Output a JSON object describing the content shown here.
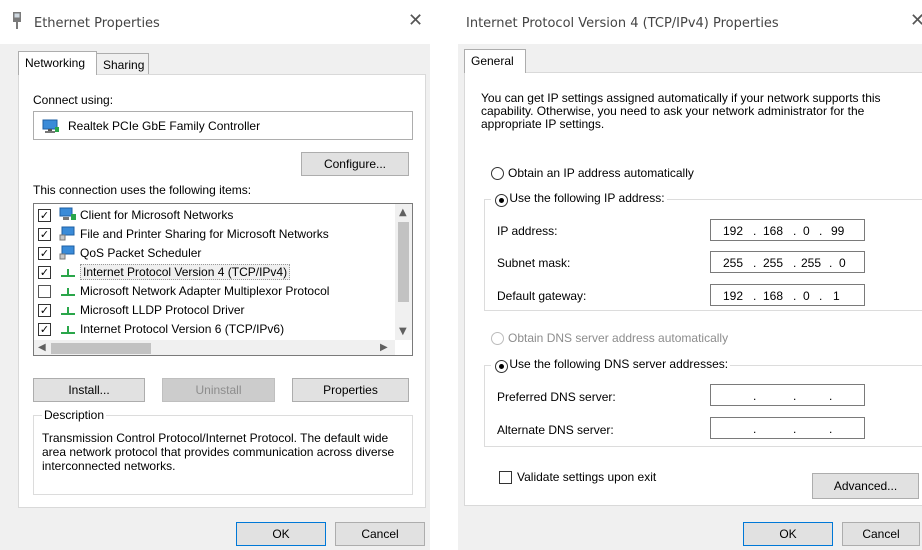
{
  "ethernet": {
    "title": "Ethernet Properties",
    "close_glyph": "✕",
    "tabs": [
      "Networking",
      "Sharing"
    ],
    "connect_using_label": "Connect using:",
    "adapter_name": "Realtek PCIe GbE Family Controller",
    "configure_label": "Configure...",
    "items_label": "This connection uses the following items:",
    "items": [
      {
        "label": "Client for Microsoft Networks",
        "checked": true,
        "icon": "network-client-icon"
      },
      {
        "label": "File and Printer Sharing for Microsoft Networks",
        "checked": true,
        "icon": "network-service-icon"
      },
      {
        "label": "QoS Packet Scheduler",
        "checked": true,
        "icon": "network-service-icon"
      },
      {
        "label": "Internet Protocol Version 4 (TCP/IPv4)",
        "checked": true,
        "selected": true,
        "icon": "protocol-icon"
      },
      {
        "label": "Microsoft Network Adapter Multiplexor Protocol",
        "checked": false,
        "icon": "protocol-icon"
      },
      {
        "label": "Microsoft LLDP Protocol Driver",
        "checked": true,
        "icon": "protocol-icon"
      },
      {
        "label": "Internet Protocol Version 6 (TCP/IPv6)",
        "checked": true,
        "icon": "protocol-icon"
      }
    ],
    "install_label": "Install...",
    "uninstall_label": "Uninstall",
    "properties_label": "Properties",
    "description_title": "Description",
    "description_text": "Transmission Control Protocol/Internet Protocol. The default wide area network protocol that provides communication across diverse interconnected networks.",
    "ok_label": "OK",
    "cancel_label": "Cancel"
  },
  "ipv4": {
    "title": "Internet Protocol Version 4 (TCP/IPv4) Properties",
    "close_glyph": "✕",
    "tab": "General",
    "intro": "You can get IP settings assigned automatically if your network supports this capability. Otherwise, you need to ask your network administrator for the appropriate IP settings.",
    "obtain_ip_auto": "Obtain an IP address automatically",
    "use_following_ip": "Use the following IP address:",
    "ip_address_label": "IP address:",
    "subnet_mask_label": "Subnet mask:",
    "gateway_label": "Default gateway:",
    "ip_address": [
      "192",
      "168",
      "0",
      "99"
    ],
    "subnet_mask": [
      "255",
      "255",
      "255",
      "0"
    ],
    "gateway": [
      "192",
      "168",
      "0",
      "1"
    ],
    "obtain_dns_auto": "Obtain DNS server address automatically",
    "use_following_dns": "Use the following DNS server addresses:",
    "preferred_dns_label": "Preferred DNS server:",
    "alternate_dns_label": "Alternate DNS server:",
    "validate_label": "Validate settings upon exit",
    "advanced_label": "Advanced...",
    "ok_label": "OK",
    "cancel_label": "Cancel"
  }
}
